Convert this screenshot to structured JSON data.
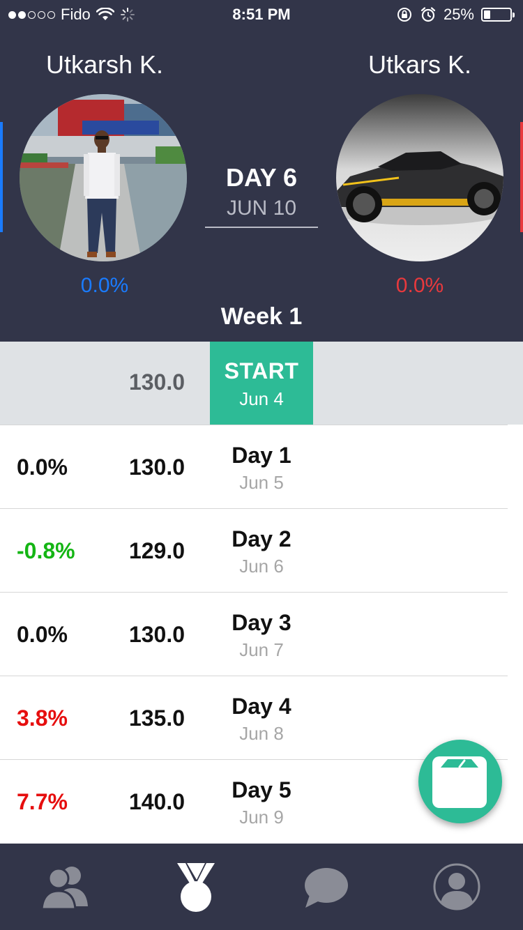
{
  "status_bar": {
    "carrier": "Fido",
    "time": "8:51 PM",
    "battery": "25%",
    "battery_level": 0.25
  },
  "competitors": {
    "left": {
      "name": "Utkarsh K.",
      "percent": "0.0%",
      "color": "#1a7bff"
    },
    "right": {
      "name": "Utkars K.",
      "percent": "0.0%",
      "color": "#e8393d"
    }
  },
  "current_day": {
    "title": "DAY 6",
    "date": "JUN 10"
  },
  "week_label": "Week 1",
  "start": {
    "weight": "130.0",
    "label": "START",
    "date": "Jun 4"
  },
  "days": [
    {
      "change": "0.0%",
      "change_color": "#111111",
      "weight": "130.0",
      "label": "Day 1",
      "date": "Jun 5"
    },
    {
      "change": "-0.8%",
      "change_color": "#14b514",
      "weight": "129.0",
      "label": "Day 2",
      "date": "Jun 6"
    },
    {
      "change": "0.0%",
      "change_color": "#111111",
      "weight": "130.0",
      "label": "Day 3",
      "date": "Jun 7"
    },
    {
      "change": "3.8%",
      "change_color": "#e60e0e",
      "weight": "135.0",
      "label": "Day 4",
      "date": "Jun 8"
    },
    {
      "change": "7.7%",
      "change_color": "#e60e0e",
      "weight": "140.0",
      "label": "Day 5",
      "date": "Jun 9"
    }
  ],
  "colors": {
    "header_bg": "#323549",
    "accent": "#2dbb96",
    "nav_icon": "#8a8c96",
    "nav_active": "#ffffff"
  },
  "nav_icons": [
    "friends-icon",
    "medal-icon",
    "chat-bubble-icon",
    "profile-icon"
  ],
  "fab_icon": "scale-icon"
}
